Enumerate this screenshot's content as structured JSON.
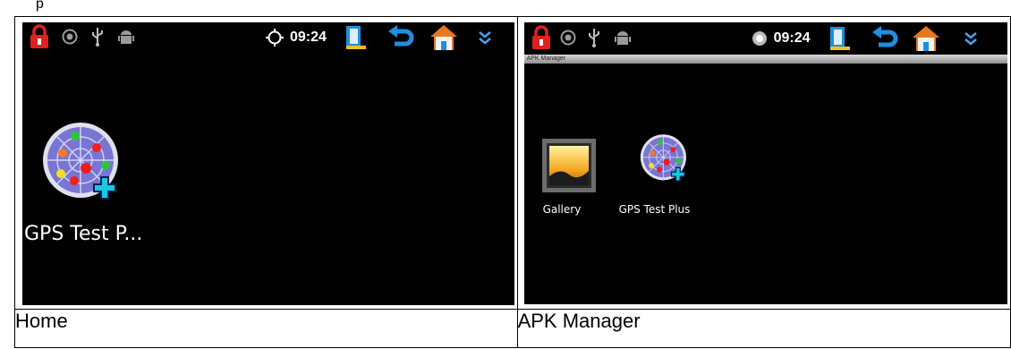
{
  "page": {
    "top_fragment": "p"
  },
  "panels": [
    {
      "caption": "Home",
      "status_bar": {
        "time": "09:24"
      },
      "apps": [
        {
          "label": "GPS Test P..."
        }
      ]
    },
    {
      "caption": "APK Manager",
      "status_bar": {
        "time": "09:24"
      },
      "title_bar": "APK Manager",
      "apps": [
        {
          "label": "Gallery"
        },
        {
          "label": "GPS Test Plus"
        }
      ]
    }
  ],
  "colors": {
    "screen_bg": "#000000",
    "lock_red": "#e02020",
    "nav_blue": "#1e8fe0",
    "home_orange": "#e87820",
    "chevron_blue": "#4aa0f0"
  },
  "icons": {
    "status_left": [
      "lock-icon",
      "settings-dial-icon",
      "usb-icon",
      "android-debug-icon"
    ],
    "status_right": [
      "gps-icon",
      "sim-card-icon",
      "back-icon",
      "home-icon",
      "chevron-down-icon"
    ]
  }
}
